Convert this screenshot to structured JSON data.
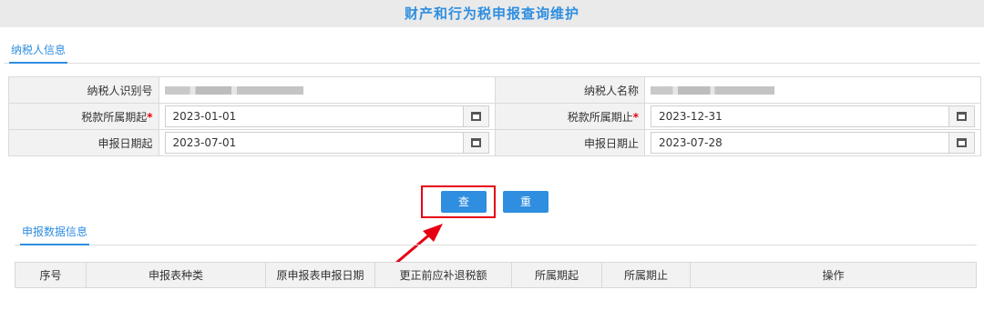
{
  "page": {
    "title": "财产和行为税申报查询维护"
  },
  "taxpayer_tab": {
    "label": "纳税人信息"
  },
  "form": {
    "taxpayer_id_label": "纳税人识别号",
    "taxpayer_name_label": "纳税人名称",
    "period_start_label": "税款所属期起",
    "period_end_label": "税款所属期止",
    "declare_start_label": "申报日期起",
    "declare_end_label": "申报日期止",
    "required_mark": "*",
    "period_start_value": "2023-01-01",
    "period_end_value": "2023-12-31",
    "declare_start_value": "2023-07-01",
    "declare_end_value": "2023-07-28"
  },
  "actions": {
    "query_label": "查询",
    "reset_label": "重置"
  },
  "data_tab": {
    "label": "申报数据信息"
  },
  "grid": {
    "columns": [
      "序号",
      "申报表种类",
      "原申报表申报日期",
      "更正前应补退税额",
      "所属期起",
      "所属期止",
      "操作"
    ]
  },
  "colors": {
    "accent": "#2f8ee0",
    "highlight": "#e60012",
    "label_bg": "#f2f2f2"
  }
}
